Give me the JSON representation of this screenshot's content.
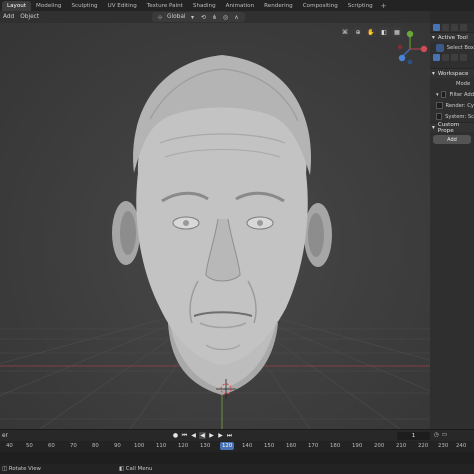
{
  "workspace_tabs": [
    "Layout",
    "Modeling",
    "Sculpting",
    "UV Editing",
    "Texture Paint",
    "Shading",
    "Animation",
    "Rendering",
    "Compositing",
    "Scripting",
    "+"
  ],
  "active_tab": "Layout",
  "header": {
    "menu_add": "Add",
    "menu_object": "Object",
    "orientation": "Global"
  },
  "sidebar": {
    "active_tool_title": "Active Tool",
    "select_box": "Select Box",
    "workspace_title": "Workspace",
    "mode_label": "Mode",
    "filter_label": "Filter Add",
    "render_label": "Render: Cy",
    "system_label": "System: Sc",
    "custom_props": "Custom Prope",
    "add_button": "Add"
  },
  "timeline": {
    "left_label": "er",
    "current_frame": "1",
    "ruler_ticks": [
      "40",
      "50",
      "60",
      "70",
      "80",
      "90",
      "100",
      "110",
      "120",
      "130",
      "140",
      "150",
      "160",
      "170",
      "180",
      "190",
      "200",
      "210",
      "220",
      "230",
      "240",
      "250"
    ],
    "current_frame_ruler": "120"
  },
  "status": {
    "left": "Rotate View",
    "right": "Call Menu"
  },
  "colors": {
    "accent": "#4772b3",
    "grid_x_axis": "#9b3f47",
    "grid_y_axis": "#7ca43f"
  }
}
